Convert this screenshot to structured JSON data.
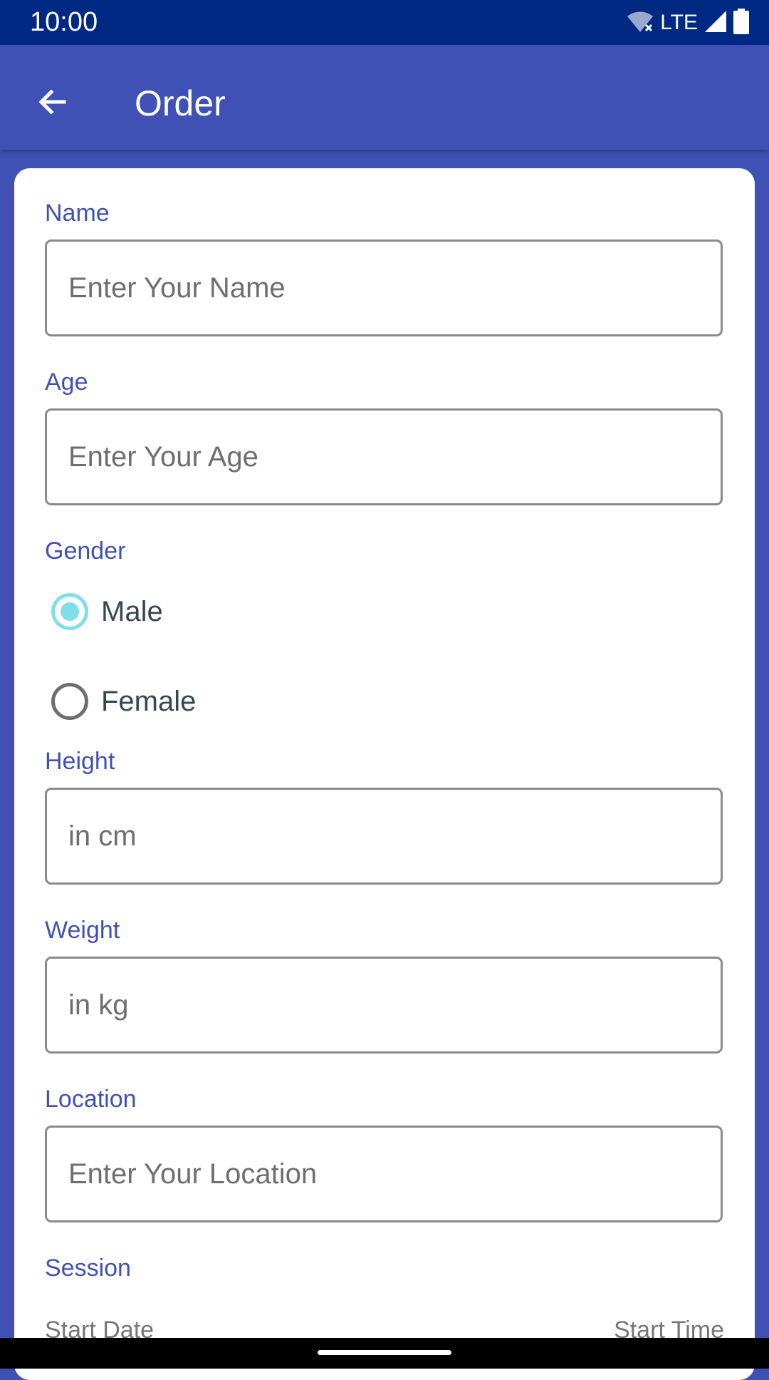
{
  "status_bar": {
    "time": "10:00",
    "network": "LTE"
  },
  "app_bar": {
    "title": "Order"
  },
  "form": {
    "name": {
      "label": "Name",
      "placeholder": "Enter Your Name",
      "value": ""
    },
    "age": {
      "label": "Age",
      "placeholder": "Enter Your Age",
      "value": ""
    },
    "gender": {
      "label": "Gender",
      "options": [
        "Male",
        "Female"
      ],
      "selected": "Male"
    },
    "height": {
      "label": "Height",
      "placeholder": "in cm",
      "value": ""
    },
    "weight": {
      "label": "Weight",
      "placeholder": "in kg",
      "value": ""
    },
    "location": {
      "label": "Location",
      "placeholder": "Enter Your Location",
      "value": ""
    },
    "session": {
      "label": "Session",
      "start_date_label": "Start Date",
      "start_time_label": "Start Time"
    }
  },
  "colors": {
    "primary": "#3f51b5",
    "primary_dark": "#002984",
    "radio_accent": "#80deea"
  }
}
